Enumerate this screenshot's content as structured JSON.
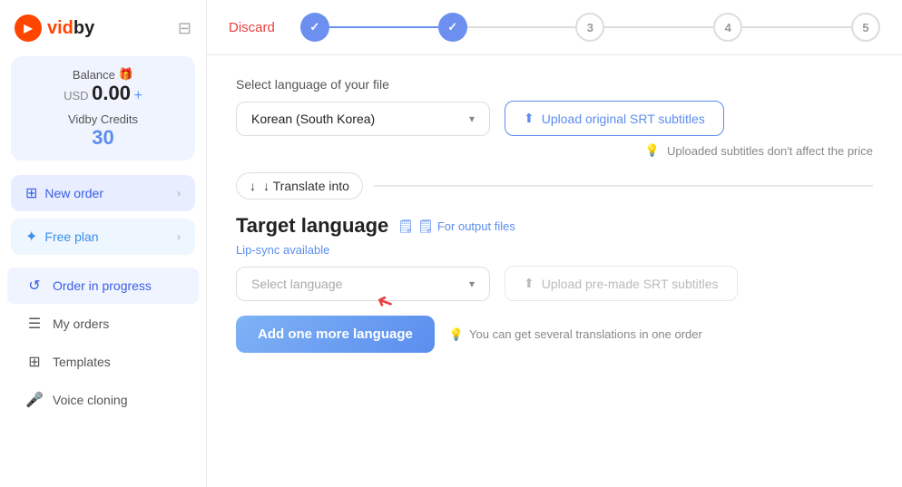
{
  "sidebar": {
    "logo": "vidby",
    "balance_label": "Balance",
    "balance_currency": "USD",
    "balance_amount": "0.00",
    "balance_add": "+",
    "credits_label": "Vidby Credits",
    "credits_amount": "30",
    "new_order_label": "New order",
    "free_plan_label": "Free plan",
    "nav_items": [
      {
        "id": "order-in-progress",
        "label": "Order in progress",
        "active": true
      },
      {
        "id": "my-orders",
        "label": "My orders",
        "active": false
      },
      {
        "id": "templates",
        "label": "Templates",
        "active": false
      },
      {
        "id": "voice-cloning",
        "label": "Voice cloning",
        "active": false
      }
    ]
  },
  "topbar": {
    "discard_label": "Discard",
    "steps": [
      {
        "id": 1,
        "state": "done",
        "label": "✓"
      },
      {
        "id": 2,
        "state": "done",
        "label": "✓"
      },
      {
        "id": 3,
        "state": "pending",
        "label": "3"
      },
      {
        "id": 4,
        "state": "pending",
        "label": "4"
      },
      {
        "id": 5,
        "state": "pending",
        "label": "5"
      }
    ]
  },
  "content": {
    "file_language_label": "Select language of your file",
    "file_language_value": "Korean (South Korea)",
    "upload_srt_label": "Upload original SRT subtitles",
    "hint_uploaded": "Uploaded subtitles don't affect the price",
    "translate_into_label": "↓ Translate into",
    "target_title": "Target language",
    "for_output_label": "For output files",
    "lip_sync_label": "Lip-sync available",
    "select_language_placeholder": "Select language",
    "upload_premade_label": "Upload pre-made SRT subtitles",
    "add_language_label": "Add one more language",
    "several_translations_hint": "You can get several translations in one order"
  }
}
